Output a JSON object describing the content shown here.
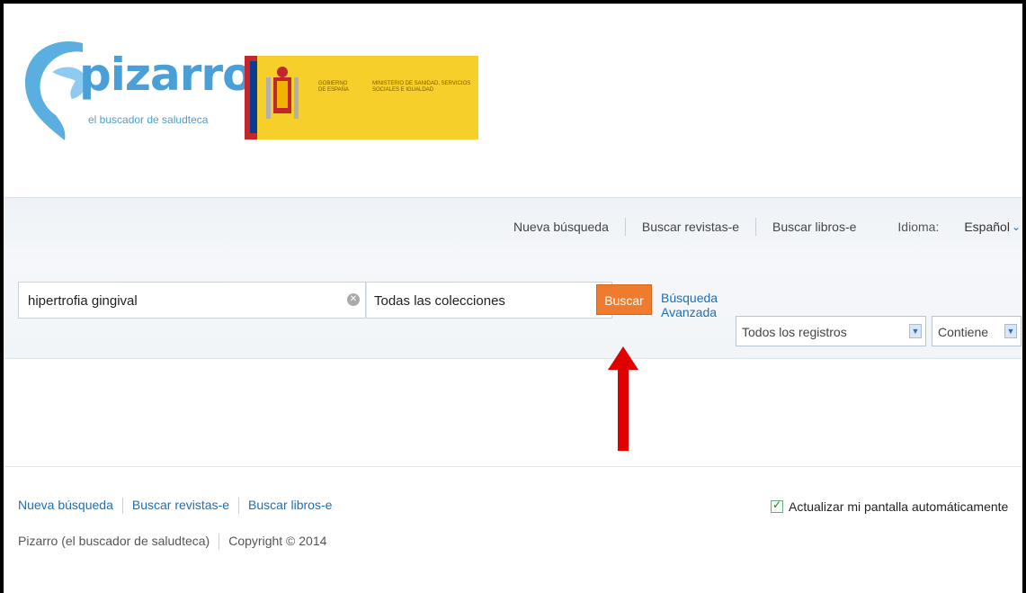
{
  "logo": {
    "wordmark": "pizarro",
    "tagline": "el buscador de saludteca"
  },
  "government_banner": {
    "gobierno": "GOBIERNO DE ESPAÑA",
    "ministerio": "MINISTERIO DE SANIDAD, SERVICIOS SOCIALES E IGUALDAD"
  },
  "nav": {
    "nueva_busqueda": "Nueva búsqueda",
    "buscar_revistas": "Buscar revistas-e",
    "buscar_libros": "Buscar libros-e",
    "idioma_label": "Idioma:",
    "idioma_value": "Español"
  },
  "search": {
    "query": "hipertrofia gingival",
    "collection": "Todas las colecciones",
    "button_label": "Buscar",
    "advanced_link": "Búsqueda Avanzada",
    "filter_scope": "Todos los registros",
    "filter_operator": "Contiene"
  },
  "footer": {
    "links": [
      "Nueva búsqueda",
      "Buscar revistas-e",
      "Buscar libros-e"
    ],
    "site_name": "Pizarro (el buscador de saludteca)",
    "copyright": "Copyright © 2014",
    "auto_update_label": "Actualizar mi pantalla automáticamente",
    "auto_update_checked": true
  },
  "colors": {
    "accent_blue": "#4a9fd6",
    "buscar_orange": "#ef7b2e",
    "annotation_red": "#e00000"
  }
}
